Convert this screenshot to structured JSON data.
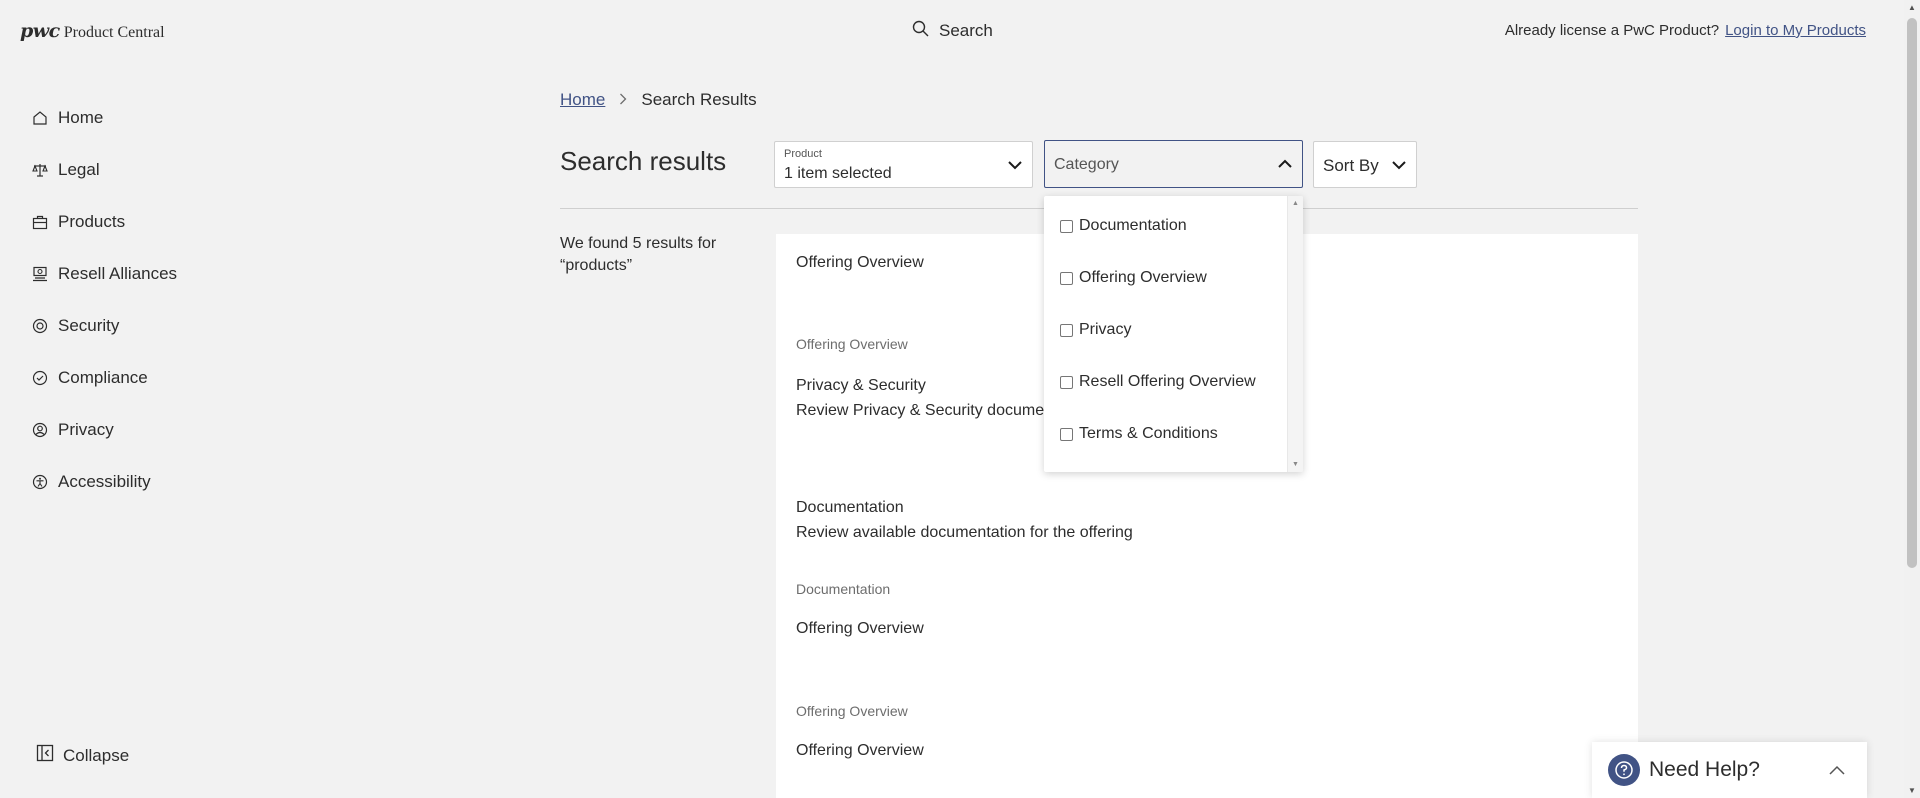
{
  "header": {
    "logo_mark": "pwc",
    "logo_text": "Product Central",
    "search_label": "Search",
    "login_prompt": "Already license a PwC Product?",
    "login_link": "Login to My Products"
  },
  "sidebar": {
    "items": [
      {
        "label": "Home",
        "icon": "home-icon"
      },
      {
        "label": "Legal",
        "icon": "scale-icon"
      },
      {
        "label": "Products",
        "icon": "briefcase-icon"
      },
      {
        "label": "Resell Alliances",
        "icon": "resell-icon"
      },
      {
        "label": "Security",
        "icon": "shield-icon"
      },
      {
        "label": "Compliance",
        "icon": "check-circle-icon"
      },
      {
        "label": "Privacy",
        "icon": "person-icon"
      },
      {
        "label": "Accessibility",
        "icon": "accessibility-icon"
      }
    ],
    "collapse_label": "Collapse"
  },
  "breadcrumb": {
    "home": "Home",
    "current": "Search Results"
  },
  "page_title": "Search results",
  "filters": {
    "product_label": "Product",
    "product_value": "1 item selected",
    "category_placeholder": "Category",
    "sort_label": "Sort By"
  },
  "results_summary": {
    "prefix": "We found ",
    "count": "5",
    "suffix": " results for",
    "query": "“products”"
  },
  "results": [
    {
      "title": "Offering Overview",
      "description": "",
      "category": "Offering Overview"
    },
    {
      "title": "Privacy & Security",
      "description": "Review Privacy & Security documentation",
      "category": ""
    },
    {
      "title": "Documentation",
      "description": "Review available documentation for the offering",
      "category": "Documentation"
    },
    {
      "title": "Offering Overview",
      "description": "",
      "category": "Offering Overview"
    },
    {
      "title": "Offering Overview",
      "description": "",
      "category": ""
    }
  ],
  "category_options": [
    {
      "label": "Documentation",
      "checked": false
    },
    {
      "label": "Offering Overview",
      "checked": false
    },
    {
      "label": "Privacy",
      "checked": false
    },
    {
      "label": "Resell Offering Overview",
      "checked": false
    },
    {
      "label": "Terms & Conditions",
      "checked": false
    }
  ],
  "help": {
    "label": "Need Help?"
  },
  "colors": {
    "accent": "#415385",
    "background": "#f2f2f2",
    "text": "#2d2d2d"
  }
}
